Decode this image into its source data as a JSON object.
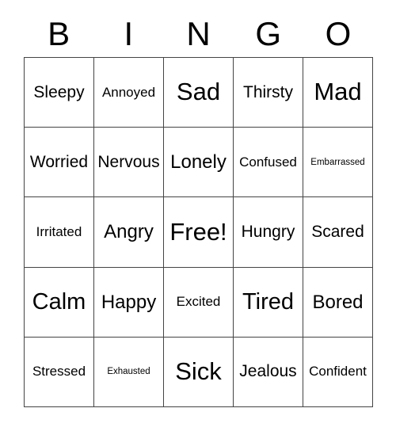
{
  "card": {
    "title": "BINGO",
    "header_letters": [
      "B",
      "I",
      "N",
      "G",
      "O"
    ],
    "grid_size": "5x5",
    "free_space_label": "Free!",
    "colors": {
      "background": "#ffffff",
      "text": "#000000",
      "border": "#444444"
    },
    "rows": [
      [
        {
          "label": "Sleepy",
          "size": "fs-sm"
        },
        {
          "label": "Annoyed",
          "size": "fs-xs"
        },
        {
          "label": "Sad",
          "size": "fs-xl"
        },
        {
          "label": "Thirsty",
          "size": "fs-sm"
        },
        {
          "label": "Mad",
          "size": "fs-xl"
        }
      ],
      [
        {
          "label": "Worried",
          "size": "fs-sm"
        },
        {
          "label": "Nervous",
          "size": "fs-sm"
        },
        {
          "label": "Lonely",
          "size": "fs-md"
        },
        {
          "label": "Confused",
          "size": "fs-xs"
        },
        {
          "label": "Embarrassed",
          "size": "fs-xxs"
        }
      ],
      [
        {
          "label": "Irritated",
          "size": "fs-xs"
        },
        {
          "label": "Angry",
          "size": "fs-md"
        },
        {
          "label": "Free!",
          "size": "fs-xl"
        },
        {
          "label": "Hungry",
          "size": "fs-sm"
        },
        {
          "label": "Scared",
          "size": "fs-sm"
        }
      ],
      [
        {
          "label": "Calm",
          "size": "fs-lg"
        },
        {
          "label": "Happy",
          "size": "fs-md"
        },
        {
          "label": "Excited",
          "size": "fs-xs"
        },
        {
          "label": "Tired",
          "size": "fs-lg"
        },
        {
          "label": "Bored",
          "size": "fs-md"
        }
      ],
      [
        {
          "label": "Stressed",
          "size": "fs-xs"
        },
        {
          "label": "Exhausted",
          "size": "fs-xxs"
        },
        {
          "label": "Sick",
          "size": "fs-xl"
        },
        {
          "label": "Jealous",
          "size": "fs-sm"
        },
        {
          "label": "Confident",
          "size": "fs-xs"
        }
      ]
    ]
  }
}
